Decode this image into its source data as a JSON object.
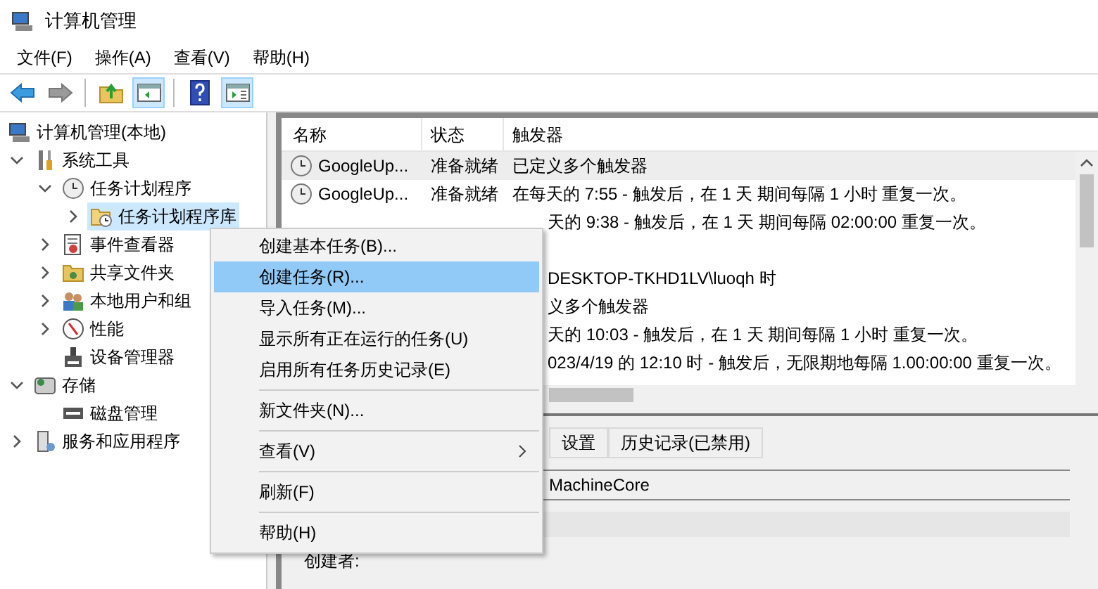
{
  "window": {
    "title": "计算机管理"
  },
  "menu_bar": [
    "文件(F)",
    "操作(A)",
    "查看(V)",
    "帮助(H)"
  ],
  "toolbar": [
    {
      "kind": "back",
      "pressed": false
    },
    {
      "kind": "forward",
      "pressed": false
    },
    {
      "kind": "up",
      "pressed": false
    },
    {
      "kind": "tree",
      "pressed": true
    },
    {
      "kind": "help",
      "pressed": false
    },
    {
      "kind": "pane",
      "pressed": true
    }
  ],
  "tree": [
    {
      "label": "计算机管理(本地)",
      "kind": "computer",
      "selected": false,
      "children": [
        {
          "label": "系统工具",
          "kind": "tools",
          "expanded": true,
          "selected": false,
          "children": [
            {
              "label": "任务计划程序",
              "kind": "clock",
              "expanded": true,
              "selected": false,
              "children": [
                {
                  "label": "任务计划程序库",
                  "kind": "folder",
                  "expanded": false,
                  "selected": true
                }
              ]
            },
            {
              "label": "事件查看器",
              "kind": "event",
              "expanded": false,
              "selected": false
            },
            {
              "label": "共享文件夹",
              "kind": "share",
              "expanded": false,
              "selected": false
            },
            {
              "label": "本地用户和组",
              "kind": "users",
              "expanded": false,
              "selected": false
            },
            {
              "label": "性能",
              "kind": "perf",
              "expanded": false,
              "selected": false
            },
            {
              "label": "设备管理器",
              "kind": "device",
              "selected": false
            }
          ]
        },
        {
          "label": "存储",
          "kind": "storage",
          "expanded": true,
          "selected": false,
          "children": [
            {
              "label": "磁盘管理",
              "kind": "disk",
              "selected": false
            }
          ]
        },
        {
          "label": "服务和应用程序",
          "kind": "services",
          "expanded": false,
          "selected": false
        }
      ]
    }
  ],
  "task_list": {
    "columns": [
      "名称",
      "状态",
      "触发器"
    ],
    "rows": [
      {
        "name": "GoogleUp...",
        "status": "准备就绪",
        "trigger": "已定义多个触发器",
        "selected": true
      },
      {
        "name": "GoogleUp...",
        "status": "准备就绪",
        "trigger": "在每天的 7:55 - 触发后，在 1 天 期间每隔 1 小时 重复一次。",
        "selected": false
      },
      {
        "trigger": "天的 9:38 - 触发后，在 1 天 期间每隔 02:00:00 重复一次。",
        "selected": false
      },
      {
        "selected": false
      },
      {
        "trigger": "DESKTOP-TKHD1LV\\luoqh 时",
        "selected": false
      },
      {
        "trigger": "义多个触发器",
        "selected": false
      },
      {
        "trigger": "天的 10:03 - 触发后，在 1 天 期间每隔 1 小时 重复一次。",
        "selected": false
      },
      {
        "trigger": "023/4/19 的 12:10 时 - 触发后，无限期地每隔 1.00:00:00 重复一次。",
        "selected": false
      }
    ]
  },
  "detail_tabs": [
    {
      "label": "设置",
      "selected": false
    },
    {
      "label": "历史记录(已禁用)",
      "selected": false
    }
  ],
  "detail_name": "MachineCore",
  "detail_author_label": "创建者:",
  "context_menu": [
    {
      "label": "创建基本任务(B)...",
      "selected": false
    },
    {
      "label": "创建任务(R)...",
      "selected": true
    },
    {
      "label": "导入任务(M)...",
      "selected": false
    },
    {
      "label": "显示所有正在运行的任务(U)",
      "selected": false
    },
    {
      "label": "启用所有任务历史记录(E)",
      "selected": false,
      "separator_after": true
    },
    {
      "label": "新文件夹(N)...",
      "selected": false,
      "separator_after": true
    },
    {
      "label": "查看(V)",
      "selected": false,
      "submenu": true,
      "separator_after": true
    },
    {
      "label": "刷新(F)",
      "selected": false,
      "separator_after": true
    },
    {
      "label": "帮助(H)",
      "selected": false
    }
  ]
}
